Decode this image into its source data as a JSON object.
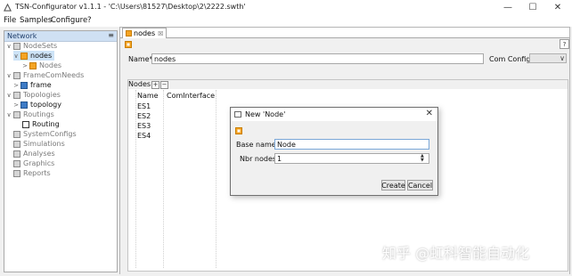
{
  "window": {
    "title": "TSN-Configurator v1.1.1 - 'C:\\Users\\81527\\Desktop\\2\\2222.swth'",
    "controls": {
      "minimize": "—",
      "maximize": "☐",
      "close": "✕"
    }
  },
  "menu": {
    "items": [
      "File",
      "Samples",
      "Configure",
      "?"
    ]
  },
  "network_panel": {
    "tab_label": "Network",
    "tab_button": "≡",
    "tree": [
      {
        "label": "NodeSets",
        "expander": "∨",
        "icon": "folder-icon"
      },
      {
        "label": "nodes",
        "expander": "∨",
        "icon": "orange-node-icon"
      },
      {
        "label": "Nodes",
        "expander": ">",
        "icon": "orange-node-icon"
      },
      {
        "label": "FrameComNeeds",
        "expander": "∨",
        "icon": "folder-icon"
      },
      {
        "label": "frame",
        "expander": ">",
        "icon": "blue-frame-icon"
      },
      {
        "label": "Topologies",
        "expander": "∨",
        "icon": "folder-icon"
      },
      {
        "label": "topology",
        "expander": ">",
        "icon": "blue-topology-icon"
      },
      {
        "label": "Routings",
        "expander": "∨",
        "icon": "folder-icon"
      },
      {
        "label": "Routing",
        "expander": "",
        "icon": "routing-icon"
      },
      {
        "label": "SystemConfigs",
        "expander": "",
        "icon": "folder-icon"
      },
      {
        "label": "Simulations",
        "expander": "",
        "icon": "folder-icon"
      },
      {
        "label": "Analyses",
        "expander": "",
        "icon": "folder-icon"
      },
      {
        "label": "Graphics",
        "expander": "",
        "icon": "folder-icon"
      },
      {
        "label": "Reports",
        "expander": "",
        "icon": "folder-icon"
      }
    ]
  },
  "editor": {
    "tab_label": "nodes",
    "tab_close": "☒",
    "help": "?",
    "name_label": "Name*",
    "name_value": "nodes",
    "com_config_label": "Com Config",
    "com_config_arrow": "∨",
    "nodes_label": "Nodes",
    "add_btn": "+",
    "remove_btn": "−",
    "columns": [
      "Name",
      "ComInterface"
    ],
    "rows": [
      "ES1",
      "ES2",
      "ES3",
      "ES4"
    ]
  },
  "dialog": {
    "title": "New 'Node'",
    "close": "✕",
    "base_name_label": "Base name",
    "base_name_value": "Node",
    "nbr_nodes_label": "Nbr nodes",
    "nbr_nodes_value": "1",
    "create_label": "Create",
    "cancel_label": "Cancel"
  },
  "watermark": {
    "text_left": "知乎",
    "text_right": "@虹科智能自动化"
  },
  "colors": {
    "selection": "#cde3f7",
    "panel_tab": "#cfe0f3",
    "orange_icon": "#f4a423",
    "blue_icon": "#3d7bc6"
  }
}
